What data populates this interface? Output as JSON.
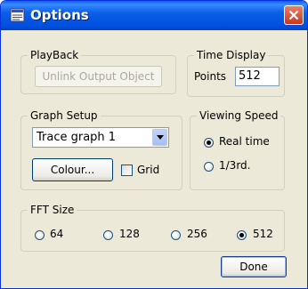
{
  "window": {
    "title": "Options"
  },
  "playback": {
    "legend": "PlayBack",
    "unlink_label": "Unlink Output Object"
  },
  "time_display": {
    "legend": "Time Display",
    "points_label": "Points",
    "points_value": "512"
  },
  "graph_setup": {
    "legend": "Graph Setup",
    "graph_selected": "Trace graph 1",
    "colour_label": "Colour...",
    "grid_label": "Grid",
    "grid_checked": false
  },
  "viewing_speed": {
    "legend": "Viewing Speed",
    "options": [
      {
        "label": "Real time",
        "selected": true
      },
      {
        "label": "1/3rd.",
        "selected": false
      }
    ]
  },
  "fft_size": {
    "legend": "FFT Size",
    "options": [
      {
        "label": "64",
        "selected": false
      },
      {
        "label": "128",
        "selected": false
      },
      {
        "label": "256",
        "selected": false
      },
      {
        "label": "512",
        "selected": true
      }
    ]
  },
  "done_label": "Done"
}
